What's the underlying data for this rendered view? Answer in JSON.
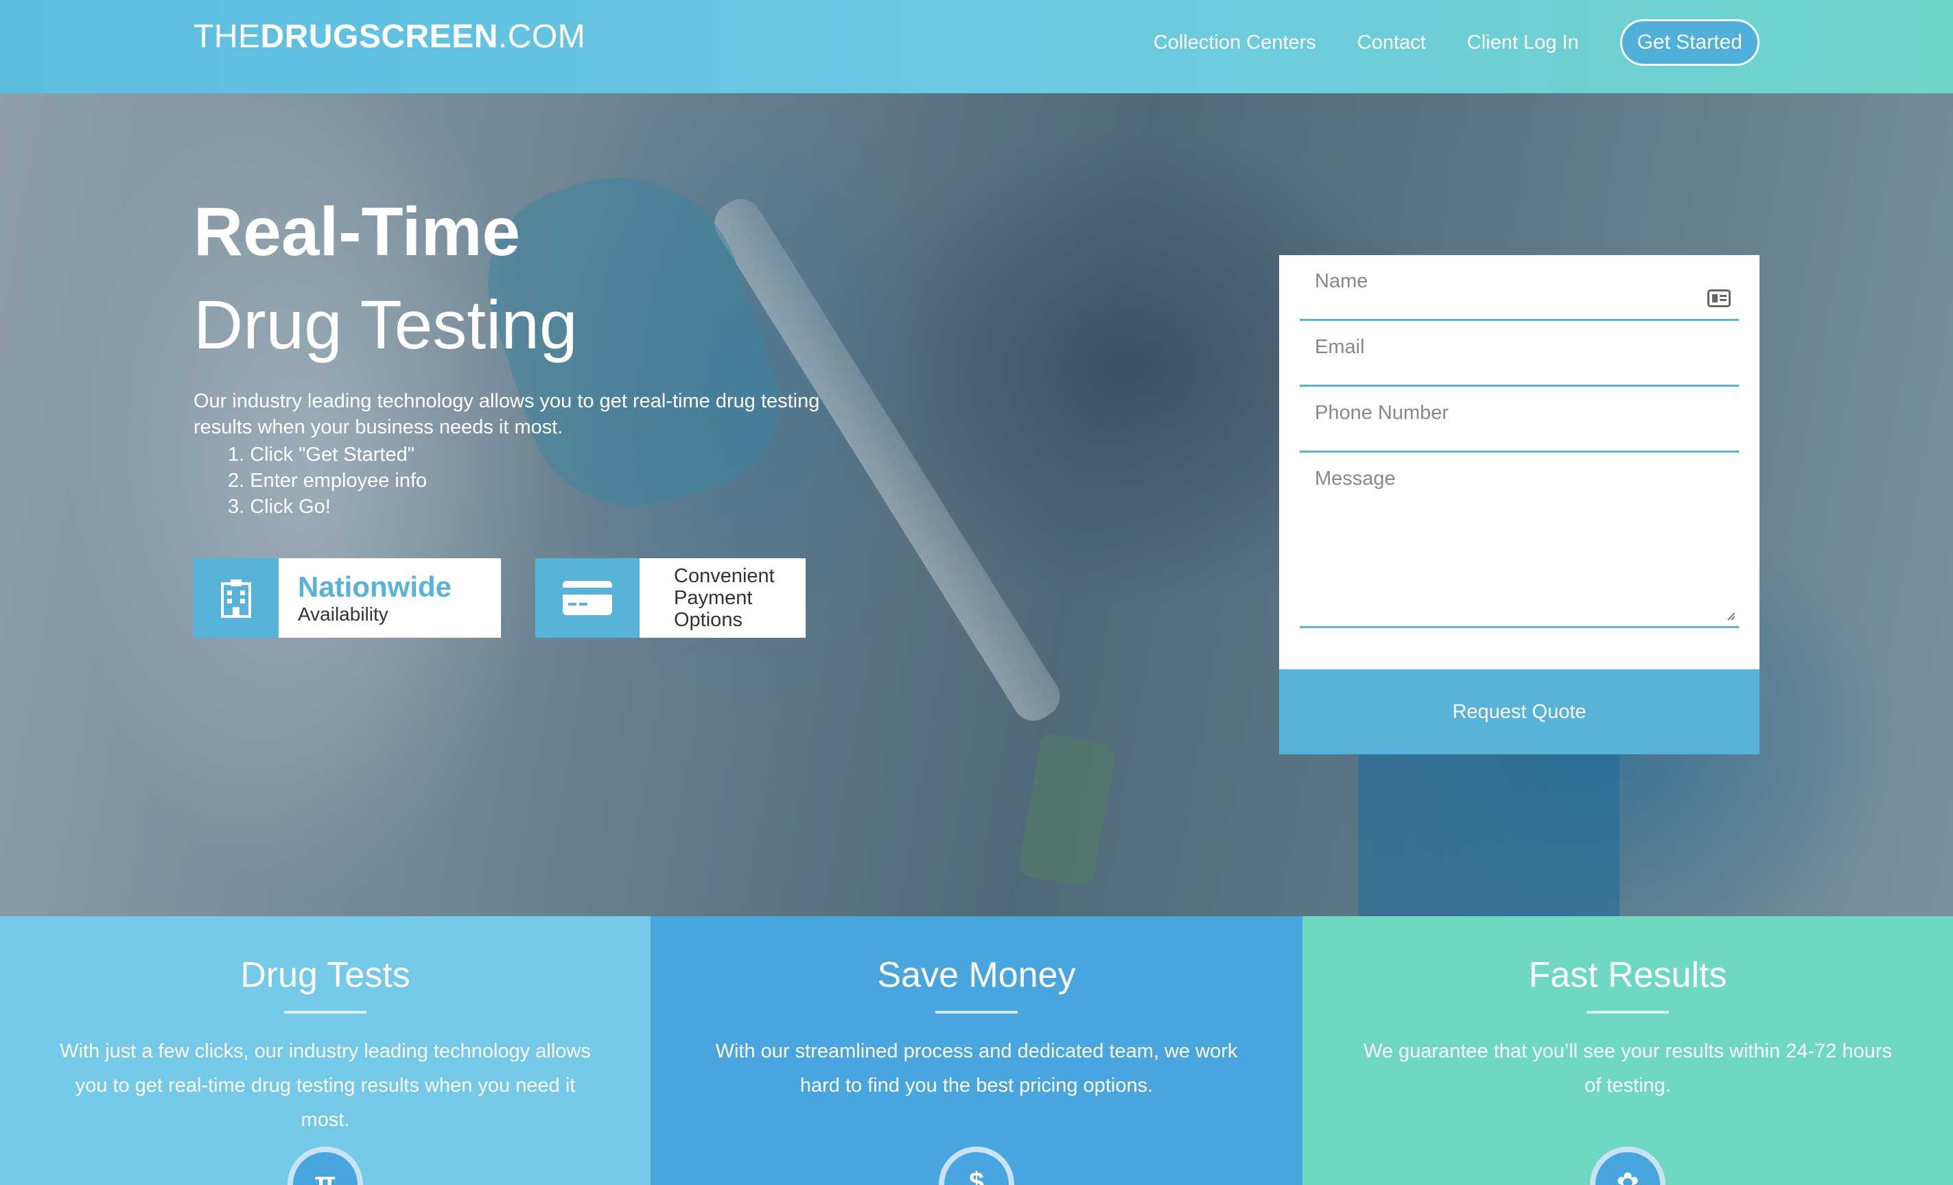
{
  "header": {
    "logo_light_prefix": "THE",
    "logo_bold": "DRUGSCREEN",
    "logo_light_suffix": ".COM",
    "nav": [
      {
        "label": "Collection Centers"
      },
      {
        "label": "Contact"
      },
      {
        "label": "Client Log In"
      }
    ],
    "cta_label": "Get Started"
  },
  "hero": {
    "title_line1": "Real-Time",
    "title_line2": "Drug Testing",
    "intro": "Our industry leading technology allows you to get real-time drug testing results when your business needs it most.",
    "steps": [
      "1. Click \"Get Started\"",
      "2. Enter employee info",
      "3. Click Go!"
    ],
    "features": [
      {
        "icon": "building-icon",
        "title": "Nationwide",
        "subtitle": "Availability"
      },
      {
        "icon": "credit-card-icon",
        "line1": "Convenient",
        "line2": "Payment",
        "line3": "Options"
      }
    ]
  },
  "form": {
    "name_placeholder": "Name",
    "email_placeholder": "Email",
    "phone_placeholder": "Phone Number",
    "message_placeholder": "Message",
    "submit_label": "Request Quote"
  },
  "panels": [
    {
      "title": "Drug Tests",
      "text": "With just a few clicks, our industry leading technology allows you to get real-time drug testing results when you need it most.",
      "icon": "pi-icon",
      "color": "#74c9e8"
    },
    {
      "title": "Save Money",
      "text": "With our streamlined process and dedicated team, we work hard to find you the best pricing options.",
      "icon": "dollar-icon",
      "color": "#49a5de"
    },
    {
      "title": "Fast Results",
      "text": "We guarantee that you’ll see your results within 24-72 hours of testing.",
      "icon": "palette-icon",
      "color": "#6fd8c2"
    }
  ],
  "panel_icons": [
    "π",
    "$",
    "✿"
  ],
  "colors": {
    "accent": "#57b3d9",
    "header_start": "#5bbde0",
    "header_end": "#6fd4c8"
  }
}
